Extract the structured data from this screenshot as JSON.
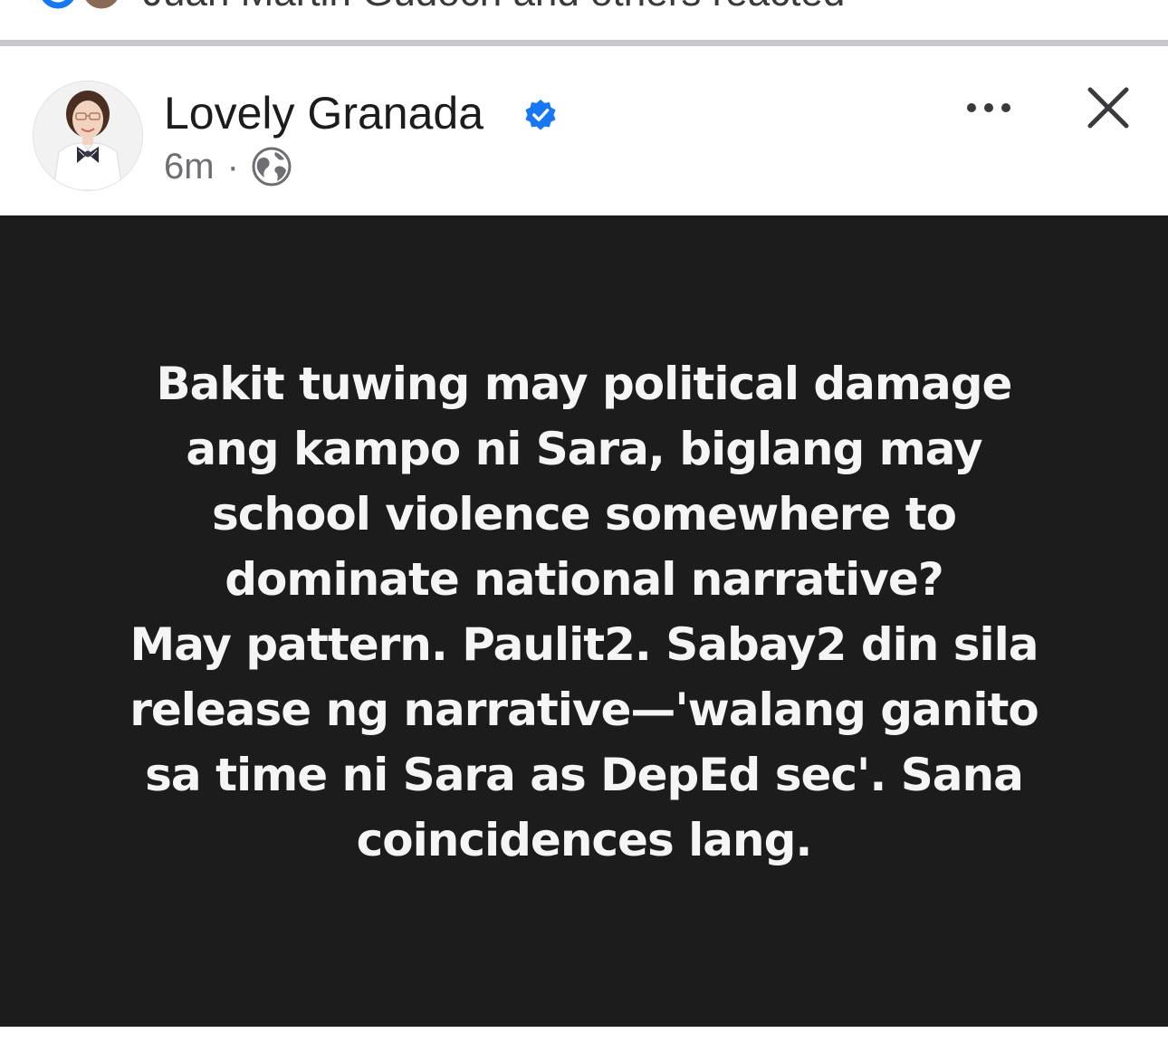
{
  "reactions": {
    "summary_text": "Juan Martin Gudoch and others reacted"
  },
  "post": {
    "author": "Lovely Granada",
    "verified": true,
    "time": "6m",
    "separator": "·",
    "audience_icon": "globe-icon",
    "more_icon": "more-horizontal-icon",
    "close_icon": "close-icon",
    "body_lines": [
      "Bakit tuwing may political damage",
      "ang kampo ni Sara, biglang may",
      "school violence somewhere to",
      "dominate national narrative?",
      "May pattern. Paulit2. Sabay2 din sila",
      "release ng narrative—'walang ganito",
      "sa time ni Sara as DepEd sec'. Sana",
      "coincidences lang."
    ]
  },
  "colors": {
    "post_background": "#1c1c1c",
    "post_text": "#f5f5f5",
    "verified_blue": "#1877f2",
    "meta_gray": "#6e6e73"
  }
}
